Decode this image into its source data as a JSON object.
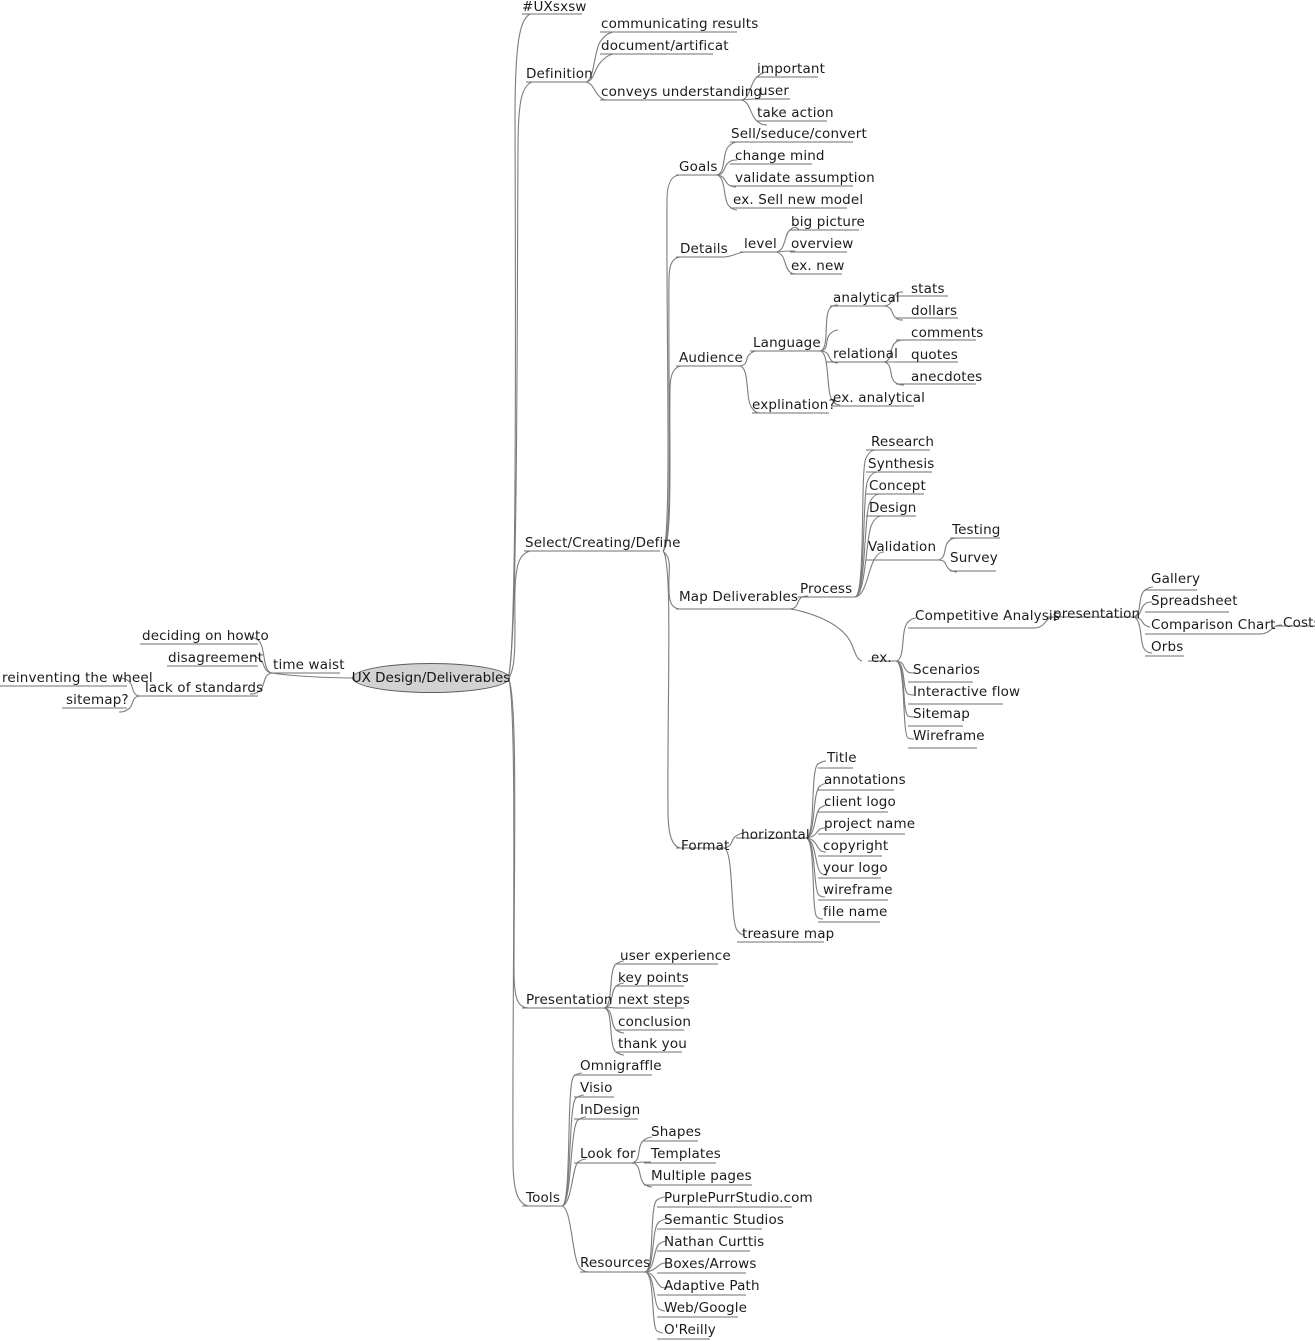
{
  "document": {
    "type": "mind-map",
    "title": "UX Design/Deliverables",
    "background_color": "#ffffff",
    "line_color": "#7c7c7c",
    "text_color": "#1b1b1b",
    "central_fill": "#d2d2d2",
    "central_stroke": "#5c5c5c"
  },
  "central": {
    "label": "UX Design/Deliverables"
  },
  "nodes": {
    "hash_uxsxsw": "#UXsxsw",
    "definition": "Definition",
    "communicating_results": "communicating results",
    "document_artificat": "document/artificat",
    "conveys_understanding": "conveys understanding",
    "important": "important",
    "user": "user",
    "take_action": "take action",
    "select_creating_define": "Select/Creating/Define",
    "goals": "Goals",
    "sell_seduce_convert": "Sell/seduce/convert",
    "change_mind": "change mind",
    "validate_assumption": "validate assumption",
    "ex_sell_new_model": "ex. Sell new model",
    "details": "Details",
    "level": "level",
    "big_picture": "big picture",
    "overview": "overview",
    "ex_new": "ex. new",
    "audience": "Audience",
    "language": "Language",
    "analytical": "analytical",
    "stats": "stats",
    "dollars": "dollars",
    "relational": "relational",
    "comments": "comments",
    "quotes": "quotes",
    "anecdotes": "anecdotes",
    "ex_analytical": "ex. analytical",
    "explination": "explination?",
    "map_deliverables": "Map Deliverables",
    "process": "Process",
    "research": "Research",
    "synthesis": "Synthesis",
    "concept": "Concept",
    "design": "Design",
    "validation": "Validation",
    "testing": "Testing",
    "survey": "Survey",
    "ex": "ex.",
    "competitive_analysis": "Competitive Analysis",
    "presentation_sub": "presentation",
    "gallery": "Gallery",
    "spreadsheet": "Spreadsheet",
    "comparison_chart": "Comparison Chart",
    "costs": "Costs",
    "orbs": "Orbs",
    "scenarios": "Scenarios",
    "interactive_flow": "Interactive flow",
    "sitemap_node": "Sitemap",
    "wireframe_node": "Wireframe",
    "format": "Format",
    "horizontal": "horizontal",
    "title_item": "Title",
    "annotations": "annotations",
    "client_logo": "client logo",
    "project_name": "project name",
    "copyright": "copyright",
    "your_logo": "your logo",
    "wireframe_item": "wireframe",
    "file_name": "file name",
    "treasure_map": "treasure map",
    "presentation": "Presentation",
    "user_experience": "user experience",
    "key_points": "key points",
    "next_steps": "next steps",
    "conclusion": "conclusion",
    "thank_you": "thank you",
    "tools": "Tools",
    "omnigraffle": "Omnigraffle",
    "visio": "Visio",
    "indesign": "InDesign",
    "look_for": "Look for",
    "shapes": "Shapes",
    "templates": "Templates",
    "multiple_pages": "Multiple pages",
    "resources": "Resources",
    "purplepurrstudio": "PurplePurrStudio.com",
    "semantic_studios": "Semantic Studios",
    "nathan_curttis": "Nathan Curttis",
    "boxes_arrows": "Boxes/Arrows",
    "adaptive_path": "Adaptive Path",
    "web_google": "Web/Google",
    "oreilly": "O'Reilly",
    "time_waist": "time waist",
    "deciding_on_howto": "deciding on howto",
    "disagreement": "disagreement",
    "lack_of_standards": "lack of standards",
    "reinventing_the_wheel": "reinventing the wheel",
    "sitemap_q": "sitemap?"
  }
}
